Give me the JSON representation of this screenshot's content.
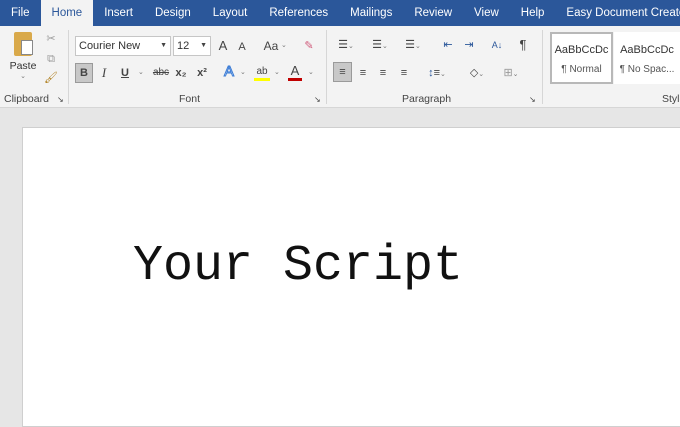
{
  "tabs": [
    "File",
    "Home",
    "Insert",
    "Design",
    "Layout",
    "References",
    "Mailings",
    "Review",
    "View",
    "Help",
    "Easy Document Creator"
  ],
  "active_tab": "Home",
  "clipboard": {
    "paste_label": "Paste",
    "group_label": "Clipboard"
  },
  "font": {
    "name": "Courier New",
    "size": "12",
    "group_label": "Font",
    "change_case": "Aa",
    "strike": "abc",
    "grow": "A",
    "shrink": "A",
    "bold": "B",
    "italic": "I",
    "underline": "U",
    "subscript": "x₂",
    "superscript": "x²",
    "effects": "A",
    "highlight": "ab",
    "font_color": "A"
  },
  "paragraph": {
    "group_label": "Paragraph",
    "pilcrow": "¶",
    "sort": "A↓"
  },
  "styles": {
    "group_label": "Styles",
    "items": [
      {
        "preview": "AaBbCcDc",
        "name": "¶ Normal"
      },
      {
        "preview": "AaBbCcDc",
        "name": "¶ No Spac..."
      }
    ]
  },
  "document": {
    "text": "Your Script"
  },
  "colors": {
    "ribbon_blue": "#2b579a",
    "highlight": "#ffff00",
    "font_color": "#c00000"
  }
}
